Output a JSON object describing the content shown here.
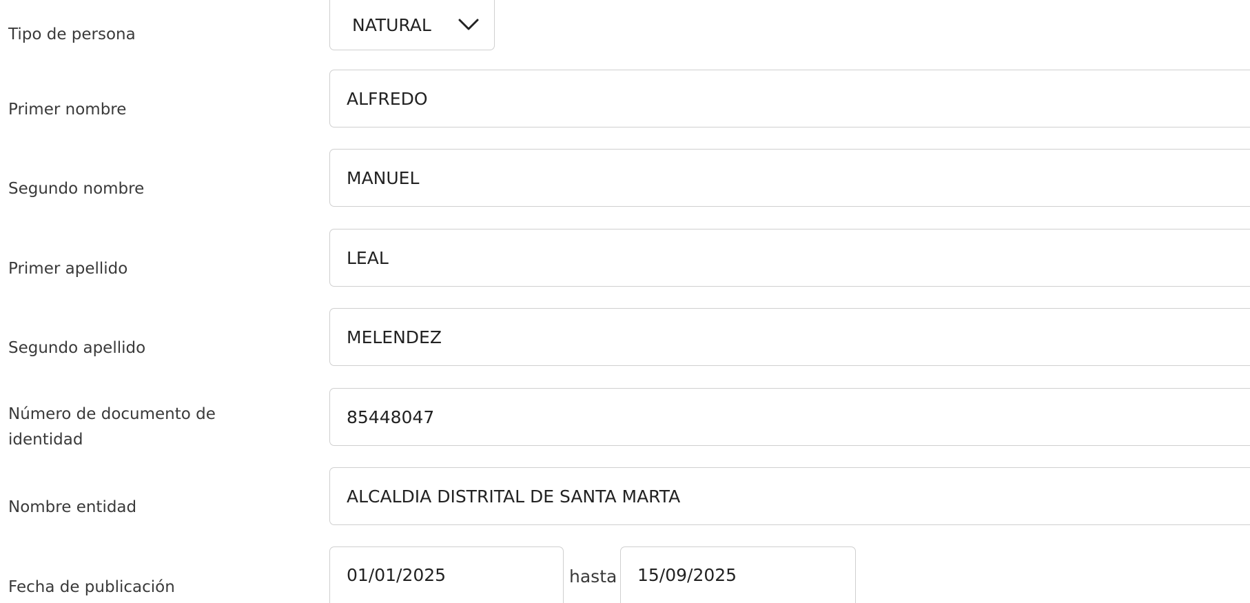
{
  "form": {
    "tipo_persona": {
      "label": "Tipo de persona",
      "value": "NATURAL"
    },
    "primer_nombre": {
      "label": "Primer nombre",
      "value": "ALFREDO"
    },
    "segundo_nombre": {
      "label": "Segundo nombre",
      "value": "MANUEL"
    },
    "primer_apellido": {
      "label": "Primer apellido",
      "value": "LEAL"
    },
    "segundo_apellido": {
      "label": "Segundo apellido",
      "value": "MELENDEZ"
    },
    "numero_documento": {
      "label_line1": "Número de documento de",
      "label_line2": "identidad",
      "value": "85448047"
    },
    "nombre_entidad": {
      "label": "Nombre entidad",
      "value": "ALCALDIA DISTRITAL DE SANTA MARTA"
    },
    "fecha_publicacion": {
      "label": "Fecha de publicación",
      "from": "01/01/2025",
      "separator": "hasta",
      "to": "15/09/2025"
    }
  },
  "icons": {
    "dropdown": "chevron-down-icon"
  },
  "colors": {
    "border": "#cfcfcf",
    "text": "#222222",
    "label": "#3a3a3a"
  }
}
